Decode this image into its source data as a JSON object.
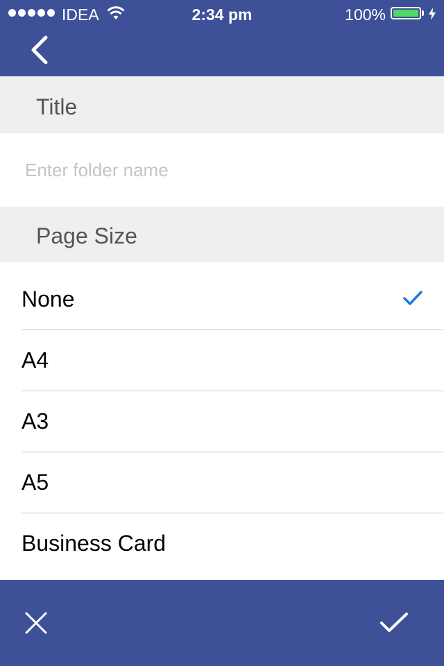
{
  "status_bar": {
    "carrier": "IDEA",
    "time": "2:34 pm",
    "battery_percent": "100%",
    "signal_bars": 5,
    "battery_level": 1.0,
    "icons": [
      "signal-dots-icon",
      "wifi-icon",
      "battery-icon",
      "charging-bolt-icon"
    ]
  },
  "nav": {
    "back_icon": "chevron-left-icon"
  },
  "title_section": {
    "header": "Title",
    "input_value": "",
    "input_placeholder": "Enter folder name"
  },
  "page_size_section": {
    "header": "Page Size",
    "selected": "None",
    "options": [
      {
        "label": "None",
        "selected": true
      },
      {
        "label": "A4",
        "selected": false
      },
      {
        "label": "A3",
        "selected": false
      },
      {
        "label": "A5",
        "selected": false
      },
      {
        "label": "Business Card",
        "selected": false
      }
    ],
    "check_icon": "checkmark-icon"
  },
  "toolbar": {
    "cancel_icon": "close-icon",
    "confirm_icon": "checkmark-icon"
  },
  "colors": {
    "brand": "#3e5198",
    "section_bg": "#efefef",
    "check": "#1a7ddc",
    "battery_fill": "#4cd964"
  }
}
